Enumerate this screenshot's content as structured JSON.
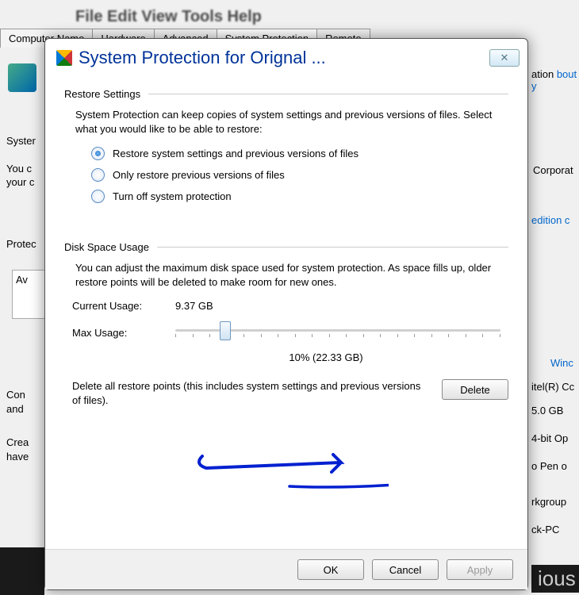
{
  "background": {
    "menu": "File  Edit  View  Tools  Help",
    "tabs": [
      "Computer Name",
      "Hardware",
      "Advanced",
      "System Protection",
      "Remote"
    ],
    "activeTab": 3,
    "sideText": {
      "system": "Syster",
      "you": "You c",
      "your": "your c",
      "protec": "Protec",
      "av": "Av",
      "con": "Con",
      "and": "and",
      "crea": "Crea",
      "have": "have"
    },
    "rightText": {
      "ation": "ation",
      "bouty": "bout y",
      "corporat": "Corporat",
      "edition": "edition c",
      "winc": "Winc",
      "intel": "itel(R) Cc",
      "mem": "5.0 GB",
      "bit": "4-bit Op",
      "pen": "o Pen o",
      "wg": "rkgroup",
      "pc": "ck-PC",
      "ious": "ious"
    }
  },
  "dialog": {
    "title": "System Protection for Orignal ...",
    "restore": {
      "header": "Restore Settings",
      "desc": "System Protection can keep copies of system settings and previous versions of files. Select what you would like to be able to restore:",
      "options": [
        "Restore system settings and previous versions of files",
        "Only restore previous versions of files",
        "Turn off system protection"
      ],
      "selected": 0
    },
    "disk": {
      "header": "Disk Space Usage",
      "desc": "You can adjust the maximum disk space used for system protection. As space fills up, older restore points will be deleted to make room for new ones.",
      "currentLabel": "Current Usage:",
      "currentValue": "9.37 GB",
      "maxLabel": "Max Usage:",
      "maxValue": "10% (22.33 GB)",
      "sliderPercent": 15,
      "deleteDesc": "Delete all restore points (this includes system settings and previous versions of files).",
      "deleteBtn": "Delete"
    },
    "buttons": {
      "ok": "OK",
      "cancel": "Cancel",
      "apply": "Apply"
    }
  }
}
